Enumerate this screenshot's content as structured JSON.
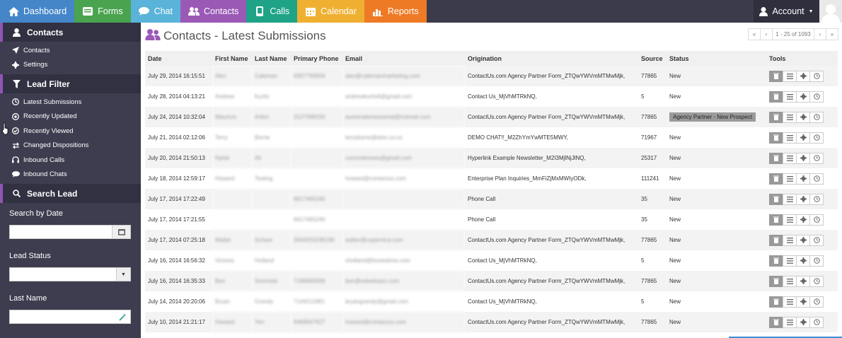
{
  "nav": {
    "items": [
      {
        "label": "Dashboard",
        "color": "#4486c8"
      },
      {
        "label": "Forms",
        "color": "#4aa34f"
      },
      {
        "label": "Chat",
        "color": "#5ab3d8"
      },
      {
        "label": "Contacts",
        "color": "#9b59b6"
      },
      {
        "label": "Calls",
        "color": "#1fa387"
      },
      {
        "label": "Calendar",
        "color": "#efb032"
      },
      {
        "label": "Reports",
        "color": "#ef7a26"
      }
    ],
    "account_label": "Account"
  },
  "sidebar": {
    "contacts_header": "Contacts",
    "contacts_items": [
      "Contacts",
      "Settings"
    ],
    "lead_filter_header": "Lead Filter",
    "lead_filter_items": [
      "Latest Submissions",
      "Recently Updated",
      "Recently Viewed",
      "Changed Dispositions",
      "Inbound Calls",
      "Inbound Chats"
    ],
    "search_header": "Search Lead",
    "search_by_date_label": "Search by Date",
    "lead_status_label": "Lead Status",
    "last_name_label": "Last Name"
  },
  "main": {
    "title": "Contacts - Latest Submissions",
    "pager_info": "1 - 25 of 1093",
    "columns": [
      "Date",
      "First Name",
      "Last Name",
      "Primary Phone",
      "Email",
      "Origination",
      "Source",
      "Status",
      "Tools"
    ],
    "rows": [
      {
        "date": "July 29, 2014 16:15:51",
        "first": "Alex",
        "last": "Caleman",
        "phone": "6307793004",
        "email": "alex@calemanmarketing.com",
        "origination": "ContactUs.com Agency Partner Form_ZTQwYWVmMTMwMjk,",
        "source": "77865",
        "status": "New",
        "highlight": false
      },
      {
        "date": "July 28, 2014 04:13:21",
        "first": "Andrew",
        "last": "Kurtis",
        "phone": "",
        "email": "andrewkurtis6@gmail.com",
        "origination": "Contact Us_MjVhMTRkNQ,",
        "source": "5",
        "status": "New",
        "highlight": false
      },
      {
        "date": "July 24, 2014 10:32:04",
        "first": "Mauricio",
        "last": "Arllen",
        "phone": "3127398150",
        "email": "aumeriakenesserial@hotmail.com",
        "origination": "ContactUs.com Agency Partner Form_ZTQwYWVmMTMwMjk,",
        "source": "77865",
        "status": "Agency Partner - New Prospect",
        "highlight": true
      },
      {
        "date": "July 21, 2014 02:12:06",
        "first": "Terry",
        "last": "Borne",
        "phone": "",
        "email": "terryborne@wire.co.nz",
        "origination": "DEMO CHAT!!_M2ZhYmYwMTE5MWY,",
        "source": "71967",
        "status": "New",
        "highlight": false
      },
      {
        "date": "July 20, 2014 21:50:13",
        "first": "Kjetal",
        "last": "Ali",
        "phone": "",
        "email": "comoreknews@gmail.com",
        "origination": "Hyperlink Example Newsletter_M2I3MjlNjJlNQ,",
        "source": "25317",
        "status": "New",
        "highlight": false
      },
      {
        "date": "July 18, 2014 12:59:17",
        "first": "Howard",
        "last": "Testing",
        "phone": "",
        "email": "howard@contactus.com",
        "origination": "Enterprise Plan Inquiries_MmFiZjMxMWIyODk,",
        "source": "111241",
        "status": "New",
        "highlight": false
      },
      {
        "date": "July 17, 2014 17:22:49",
        "first": "",
        "last": "",
        "phone": "6617465240",
        "email": "",
        "origination": "Phone Call",
        "source": "35",
        "status": "New",
        "highlight": false
      },
      {
        "date": "July 17, 2014 17:21:55",
        "first": "",
        "last": "",
        "phone": "6617465240",
        "email": "",
        "origination": "Phone Call",
        "source": "35",
        "status": "New",
        "highlight": false
      },
      {
        "date": "July 17, 2014 07:25:18",
        "first": "Walter",
        "last": "Scheer",
        "phone": "3044203236190",
        "email": "walter@copernica.com",
        "origination": "ContactUs.com Agency Partner Form_ZTQwYWVmMTMwMjk,",
        "source": "77865",
        "status": "New",
        "highlight": false
      },
      {
        "date": "July 16, 2014 16:56:32",
        "first": "Victoria",
        "last": "Holland",
        "phone": "",
        "email": "vholland@boxestime.com",
        "origination": "Contact Us_MjVhMTRkNQ,",
        "source": "5",
        "status": "New",
        "highlight": false
      },
      {
        "date": "July 16, 2014 16:35:33",
        "first": "Ben",
        "last": "Smoniski",
        "phone": "7196660006",
        "email": "ben@salesbasic.com",
        "origination": "ContactUs.com Agency Partner Form_ZTQwYWVmMTMwMjk,",
        "source": "77865",
        "status": "New",
        "highlight": false
      },
      {
        "date": "July 14, 2014 20:20:06",
        "first": "Bryan",
        "last": "Grandy",
        "phone": "7144211981",
        "email": "bryangrandy@gmail.com",
        "origination": "Contact Us_MjVhMTRkNQ,",
        "source": "5",
        "status": "New",
        "highlight": false
      },
      {
        "date": "July 10, 2014 21:21:17",
        "first": "Howard",
        "last": "Yen",
        "phone": "6469947927",
        "email": "howard@contactus.com",
        "origination": "ContactUs.com Agency Partner Form_ZTQwYWVmMTMwMjk,",
        "source": "77865",
        "status": "New",
        "highlight": false
      }
    ]
  }
}
